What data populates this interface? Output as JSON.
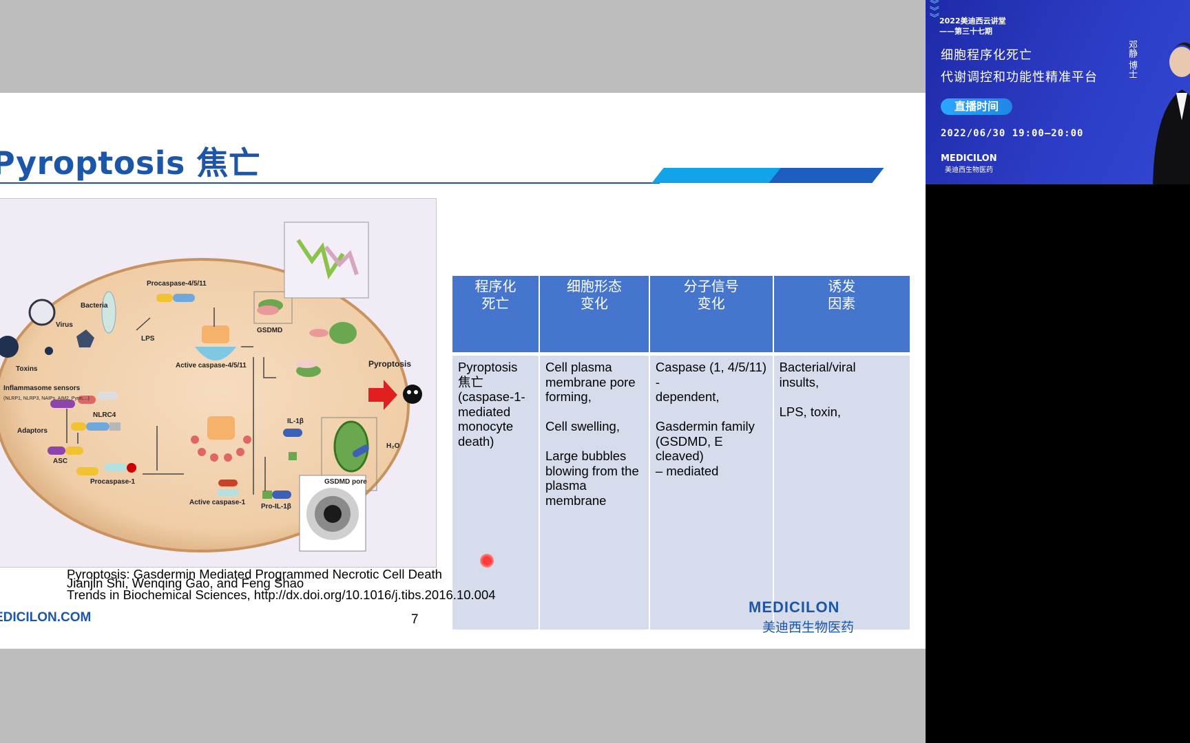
{
  "slide": {
    "title": "Pyroptosis 焦亡",
    "figure_labels": {
      "bacteria": "Bacteria",
      "virus": "Virus",
      "toxins": "Toxins",
      "lps": "LPS",
      "procaspase_4511": "Procaspase-4/5/11",
      "active_caspase_4511": "Active caspase-4/5/11",
      "gsdmd": "GSDMD",
      "pyroptosis": "Pyroptosis",
      "inflammasome_sensors": "Inflammasome sensors",
      "sensor_list": "(NLRP1, NLRP3, NAIPs, AIM2, Pyrin,...)",
      "nlrc4": "NLRC4",
      "adaptors": "Adaptors",
      "asc": "ASC",
      "procaspase_1": "Procaspase-1",
      "active_caspase_1": "Active caspase-1",
      "il1b": "IL-1β",
      "pro_il1b": "Pro-IL-1β",
      "h2o": "H₂O",
      "gsdmd_pore": "GSDMD pore"
    },
    "table": {
      "headers": [
        "程序化\n死亡",
        "细胞形态\n变化",
        "分子信号\n变化",
        "诱发\n因素"
      ],
      "row": [
        "Pyroptosis\n焦亡\n(caspase-1-\nmediated\nmonocyte\ndeath)",
        "Cell plasma\nmembrane pore\nforming,\n\nCell swelling,\n\nLarge bubbles\nblowing from the\nplasma membrane",
        "Caspase (1, 4/5/11) -\ndependent,\n\nGasdermin family\n(GSDMD, E cleaved)\n– mediated",
        "Bacterial/viral\ninsults,\n\nLPS, toxin,"
      ]
    },
    "citation": {
      "line1": "Pyroptosis: Gasdermin Mediated Programmed Necrotic Cell Death",
      "line2": "Jianjin Shi, Wenqing Gao, and Feng Shao",
      "line3": "Trends in Biochemical Sciences, http://dx.doi.org/10.1016/j.tibs.2016.10.004"
    },
    "footer_website": "EDICILON.COM",
    "page_number": "7",
    "logo_en": "MEDICILON",
    "logo_cn": "美迪西生物医药"
  },
  "video": {
    "event": "2022美迪西云讲堂",
    "episode": "——第三十七期",
    "topic_line1": "细胞程序化死亡",
    "topic_line2": "代谢调控和功能性精准平台",
    "live_label": "直播时间",
    "time": "2022/06/30 19:00—20:00",
    "brand_en": "MEDICILON",
    "brand_cn": "美迪西生物医药",
    "speaker": "邓静 博士"
  },
  "colors": {
    "title_blue": "#1b56a8",
    "table_header": "#4575cc",
    "table_cell": "#d6dcec",
    "accent_cyan": "#11a5e8"
  }
}
